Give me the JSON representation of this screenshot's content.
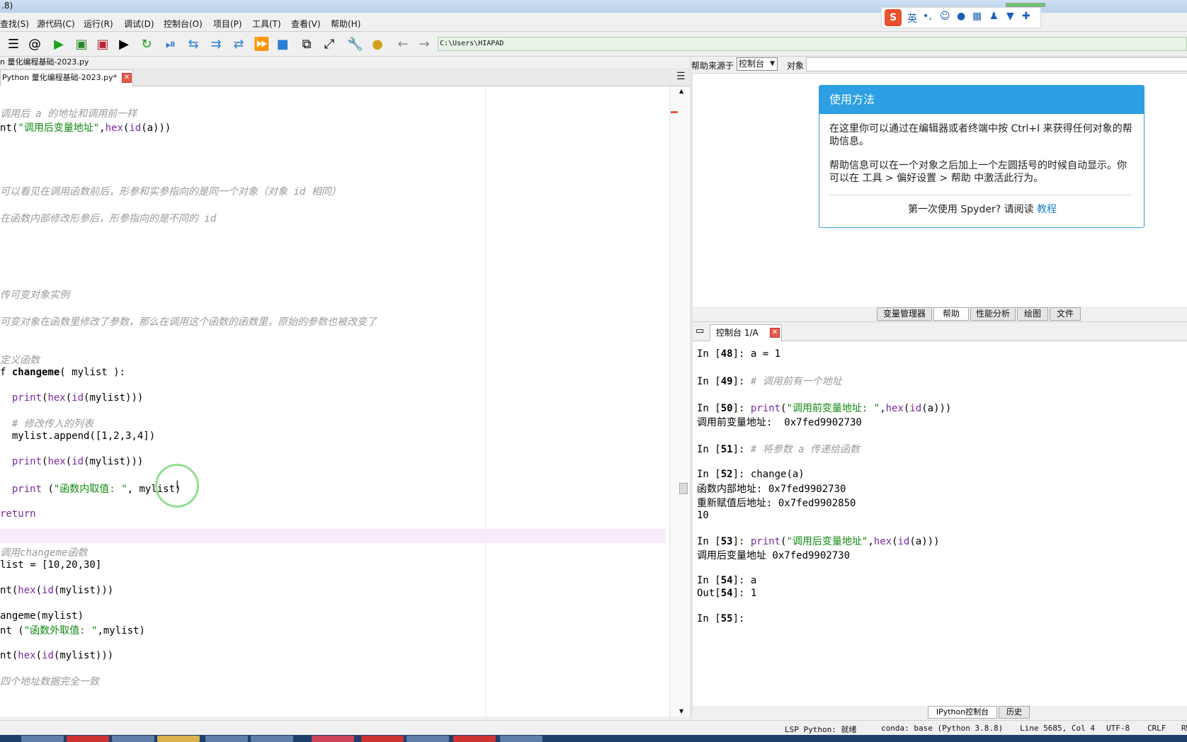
{
  "window": {
    "title_fragment": ".8)"
  },
  "menu": [
    "查找(S)",
    "源代码(C)",
    "运行(R)",
    "调试(D)",
    "控制台(O)",
    "项目(P)",
    "工具(T)",
    "查看(V)",
    "帮助(H)"
  ],
  "ime": {
    "logo": "S",
    "lang": "英",
    "punct": "•,"
  },
  "toolbar": {
    "path": "C:\\Users\\HIAPAD"
  },
  "editor": {
    "file_path_fragment": "n 量化编程基础-2023.py",
    "tab_label": "Python 量化编程基础-2023.py*",
    "lines": [
      {
        "cls": "cm",
        "t": "调用后 a 的地址和调用前一样"
      },
      {
        "parts": [
          [
            "",
            "nt("
          ],
          [
            "st",
            "\"调用后变量地址\""
          ],
          [
            "",
            ","
          ],
          [
            "nm",
            "hex"
          ],
          [
            "",
            "("
          ],
          [
            "nm",
            "id"
          ],
          [
            "",
            "(a)))"
          ]
        ]
      },
      {
        "cls": "cm",
        "t": "可以看见在调用函数前后，形参和实参指向的是同一个对象（对象 id 相同）"
      },
      {
        "cls": "cm",
        "t": "在函数内部修改形参后，形参指向的是不同的 id"
      },
      {
        "cls": "cm",
        "t": "传可变对象实例"
      },
      {
        "cls": "cm",
        "t": "可变对象在函数里修改了参数，那么在调用这个函数的函数里，原始的参数也被改变了"
      },
      {
        "cls": "cm",
        "t": "定义函数"
      },
      {
        "parts": [
          [
            "",
            "f "
          ],
          [
            "bold",
            "changeme"
          ],
          [
            "",
            "( mylist ):"
          ]
        ]
      },
      {
        "parts": [
          [
            "",
            "  "
          ],
          [
            "nm",
            "print"
          ],
          [
            "",
            "("
          ],
          [
            "nm",
            "hex"
          ],
          [
            "",
            "("
          ],
          [
            "nm",
            "id"
          ],
          [
            "",
            "(mylist)))"
          ]
        ]
      },
      {
        "cls": "cm",
        "t": "  # 修改传入的列表"
      },
      {
        "t": "  mylist.append([1,2,3,4])"
      },
      {
        "parts": [
          [
            "",
            "  "
          ],
          [
            "nm",
            "print"
          ],
          [
            "",
            "("
          ],
          [
            "nm",
            "hex"
          ],
          [
            "",
            "("
          ],
          [
            "nm",
            "id"
          ],
          [
            "",
            "(mylist)))"
          ]
        ]
      },
      {
        "parts": [
          [
            "",
            "  "
          ],
          [
            "nm",
            "print"
          ],
          [
            "",
            " ("
          ],
          [
            "st",
            "\"函数内取值: \""
          ],
          [
            "",
            ", mylist)"
          ]
        ]
      },
      {
        "parts": [
          [
            "kw",
            "return"
          ]
        ]
      },
      {
        "cls": "cm",
        "t": "调用changeme函数"
      },
      {
        "t": "list = [10,20,30]"
      },
      {
        "parts": [
          [
            "",
            "nt("
          ],
          [
            "nm",
            "hex"
          ],
          [
            "",
            "("
          ],
          [
            "nm",
            "id"
          ],
          [
            "",
            "(mylist)))"
          ]
        ]
      },
      {
        "t": "angeme(mylist)"
      },
      {
        "parts": [
          [
            "",
            "nt ("
          ],
          [
            "st",
            "\"函数外取值: \""
          ],
          [
            "",
            ",mylist)"
          ]
        ]
      },
      {
        "parts": [
          [
            "",
            "nt("
          ],
          [
            "nm",
            "hex"
          ],
          [
            "",
            "("
          ],
          [
            "nm",
            "id"
          ],
          [
            "",
            "(mylist)))"
          ]
        ]
      },
      {
        "cls": "cm",
        "t": "四个地址数据完全一致"
      }
    ]
  },
  "help": {
    "source_label": "帮助来源于",
    "source_value": "控制台",
    "object_label": "对象",
    "card_title": "使用方法",
    "para1": "在这里你可以通过在编辑器或者终端中按 Ctrl+I 来获得任何对象的帮助信息。",
    "para2": "帮助信息可以在一个对象之后加上一个左圆括号的时候自动显示。你可以在 工具 > 偏好设置 > 帮助 中激活此行为。",
    "footer_text": "第一次使用 Spyder? 请阅读",
    "footer_link": "教程"
  },
  "dock_tabs": [
    "变量管理器",
    "帮助",
    "性能分析",
    "绘图",
    "文件"
  ],
  "console": {
    "tab_label": "控制台 1/A",
    "lines": [
      {
        "p": "In [",
        "n": "48",
        "s": "]: ",
        "code": [
          [
            "",
            "a = "
          ],
          [
            "",
            "1"
          ]
        ]
      },
      {
        "p": "In [",
        "n": "49",
        "s": "]: ",
        "code": [
          [
            "cm",
            "# 调用前有一个地址"
          ]
        ]
      },
      {
        "p": "In [",
        "n": "50",
        "s": "]: ",
        "code": [
          [
            "nm",
            "print"
          ],
          [
            "",
            "("
          ],
          [
            "st",
            "\"调用前变量地址: \""
          ],
          [
            "",
            ","
          ],
          [
            "nm",
            "hex"
          ],
          [
            "",
            "("
          ],
          [
            "nm",
            "id"
          ],
          [
            "",
            "(a)))"
          ]
        ]
      },
      {
        "out": "调用前变量地址:  0x7fed9902730"
      },
      {
        "p": "In [",
        "n": "51",
        "s": "]: ",
        "code": [
          [
            "cm",
            "# 将参数 a 传递给函数"
          ]
        ]
      },
      {
        "p": "In [",
        "n": "52",
        "s": "]: ",
        "code": [
          [
            "",
            "change(a)"
          ]
        ]
      },
      {
        "out": "函数内部地址: 0x7fed9902730"
      },
      {
        "out": "重新赋值后地址: 0x7fed9902850"
      },
      {
        "out": "10"
      },
      {
        "p": "In [",
        "n": "53",
        "s": "]: ",
        "code": [
          [
            "nm",
            "print"
          ],
          [
            "",
            "("
          ],
          [
            "st",
            "\"调用后变量地址\""
          ],
          [
            "",
            ","
          ],
          [
            "nm",
            "hex"
          ],
          [
            "",
            "("
          ],
          [
            "nm",
            "id"
          ],
          [
            "",
            "(a)))"
          ]
        ]
      },
      {
        "out": "调用后变量地址 0x7fed9902730"
      },
      {
        "p": "In [",
        "n": "54",
        "s": "]: ",
        "code": [
          [
            "",
            "a"
          ]
        ]
      },
      {
        "p": "Out[",
        "n": "54",
        "s": "]: ",
        "code": [
          [
            "",
            "1"
          ]
        ]
      },
      {
        "p": "In [",
        "n": "55",
        "s": "]: ",
        "code": []
      }
    ]
  },
  "bottom_tabs": [
    "IPython控制台",
    "历史"
  ],
  "status": {
    "lsp": "LSP Python: 就绪",
    "conda": "conda: base (Python 3.8.8)",
    "position": "Line 5685, Col 4",
    "encoding": "UTF-8",
    "eol": "CRLF",
    "rw": "RW"
  },
  "colors": {
    "accent": "#2d9fe2",
    "string": "#108a10",
    "keyword": "#7a2aa0",
    "comment": "#9a9a9a"
  }
}
